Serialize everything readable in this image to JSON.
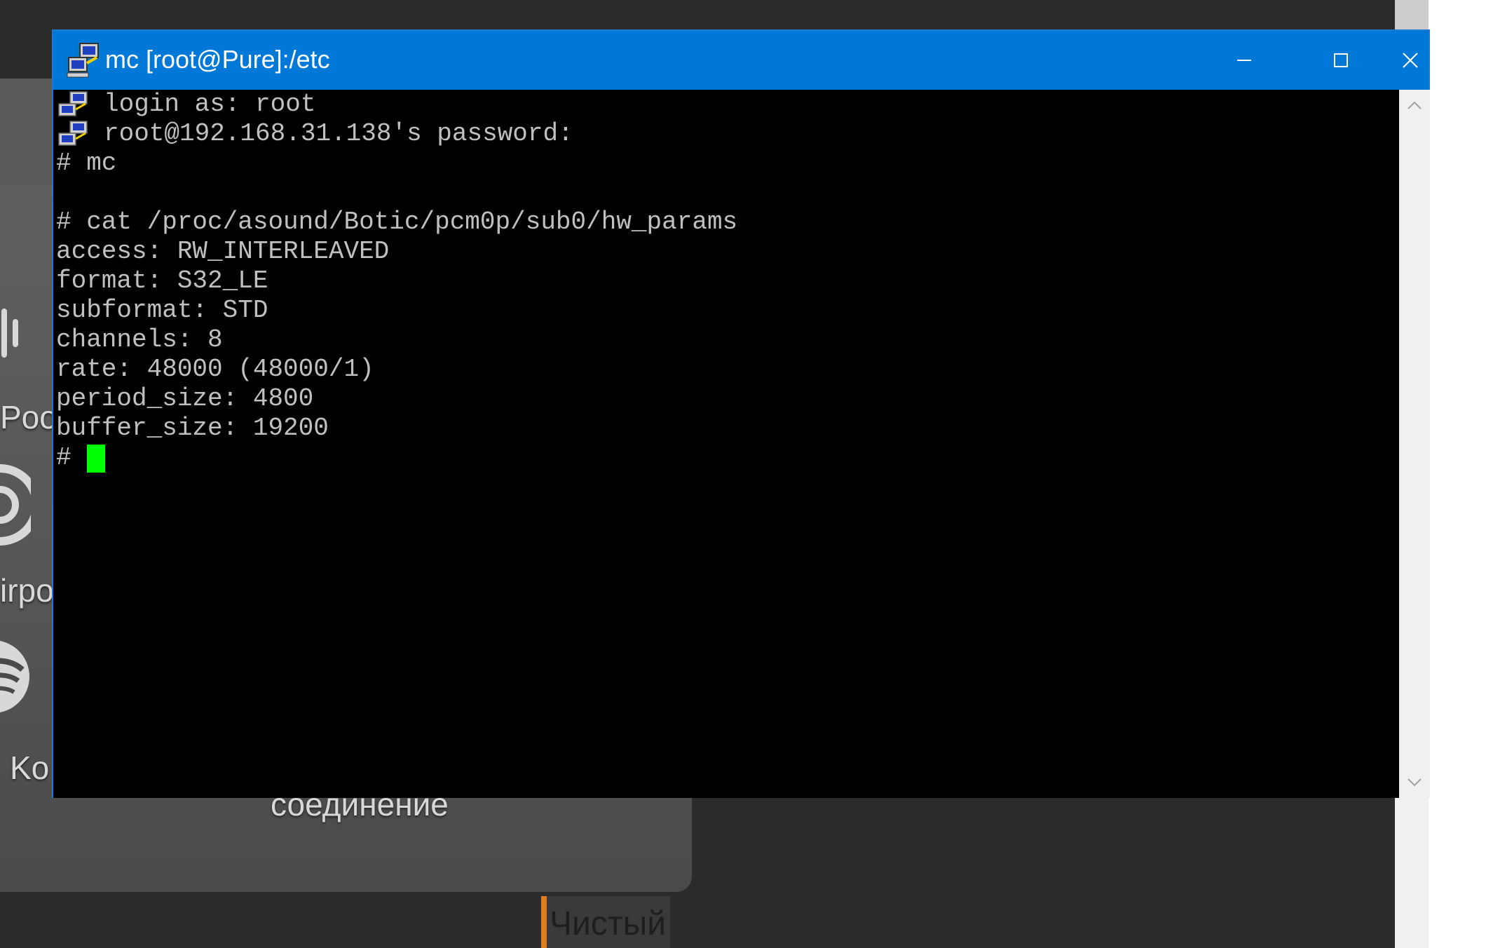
{
  "window": {
    "title": "mc [root@Pure]:/etc"
  },
  "terminal": {
    "lines": [
      "login as: root",
      "root@192.168.31.138's password:",
      "# mc",
      "",
      "# cat /proc/asound/Botic/pcm0p/sub0/hw_params",
      "access: RW_INTERLEAVED",
      "format: S32_LE",
      "subformat: STD",
      "channels: 8",
      "rate: 48000 (48000/1)",
      "period_size: 4800",
      "buffer_size: 19200",
      "# "
    ],
    "cursor_color": "#00ff00",
    "text_color": "#c0c0c0"
  },
  "background_app": {
    "labels": [
      "Poo",
      "irpo",
      "Ko",
      "соединение"
    ],
    "tab_label": "Чистый",
    "accent_color": "#e07b1f"
  },
  "colors": {
    "titlebar": "#0078d7",
    "terminal_bg": "#000000"
  }
}
